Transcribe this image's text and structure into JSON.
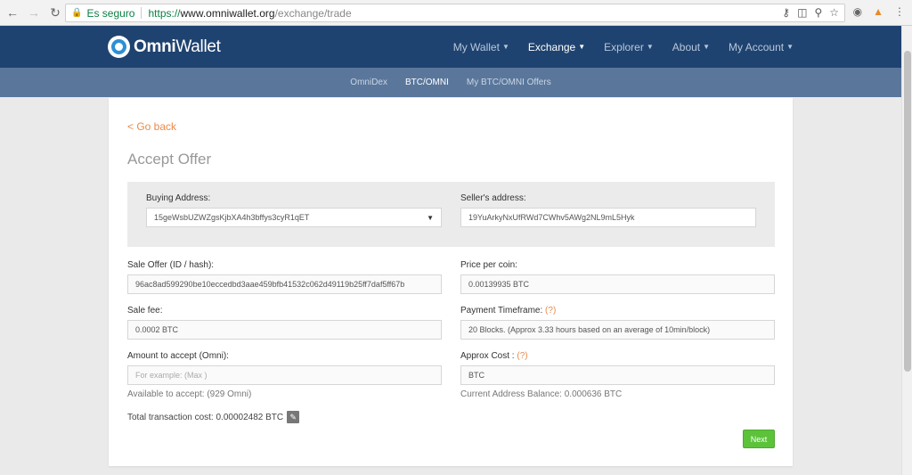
{
  "browser": {
    "secure_label": "Es seguro",
    "url_protocol": "https://",
    "url_host": "www.omniwallet.org",
    "url_path": "/exchange/trade"
  },
  "brand": {
    "name_bold": "Omni",
    "name_rest": "Wallet"
  },
  "menu": {
    "items": [
      {
        "label": "My Wallet"
      },
      {
        "label": "Exchange"
      },
      {
        "label": "Explorer"
      },
      {
        "label": "About"
      },
      {
        "label": "My Account"
      }
    ]
  },
  "submenu": {
    "items": [
      {
        "label": "OmniDex"
      },
      {
        "label": "BTC/OMNI"
      },
      {
        "label": "My BTC/OMNI Offers"
      }
    ]
  },
  "page": {
    "back_link": "< Go back",
    "title": "Accept Offer"
  },
  "form": {
    "buying_address_label": "Buying Address:",
    "buying_address_value": "15geWsbUZWZgsKjbXA4h3bffys3cyR1qET",
    "sellers_address_label": "Seller's address:",
    "sellers_address_value": "19YuArkyNxUfRWd7CWhv5AWg2NL9mL5Hyk",
    "sale_offer_label": "Sale Offer (ID / hash):",
    "sale_offer_value": "96ac8ad599290be10eccedbd3aae459bfb41532c062d49119b25ff7daf5ff67b",
    "price_per_coin_label": "Price per coin:",
    "price_per_coin_value": "0.00139935 BTC",
    "sale_fee_label": "Sale fee:",
    "sale_fee_value": "0.0002 BTC",
    "payment_timeframe_label": "Payment Timeframe:",
    "payment_timeframe_help": "(?)",
    "payment_timeframe_value": "20 Blocks. (Approx 3.33 hours based on an average of 10min/block)",
    "amount_label": "Amount to accept (Omni):",
    "amount_placeholder": "For example: (Max )",
    "available_note": "Available to accept: (929 Omni)",
    "approx_cost_label": "Approx Cost :",
    "approx_cost_help": "(?)",
    "approx_cost_value": "BTC",
    "balance_note": "Current Address Balance: 0.000636 BTC",
    "total_cost": "Total transaction cost: 0.00002482 BTC",
    "next_label": "Next"
  }
}
